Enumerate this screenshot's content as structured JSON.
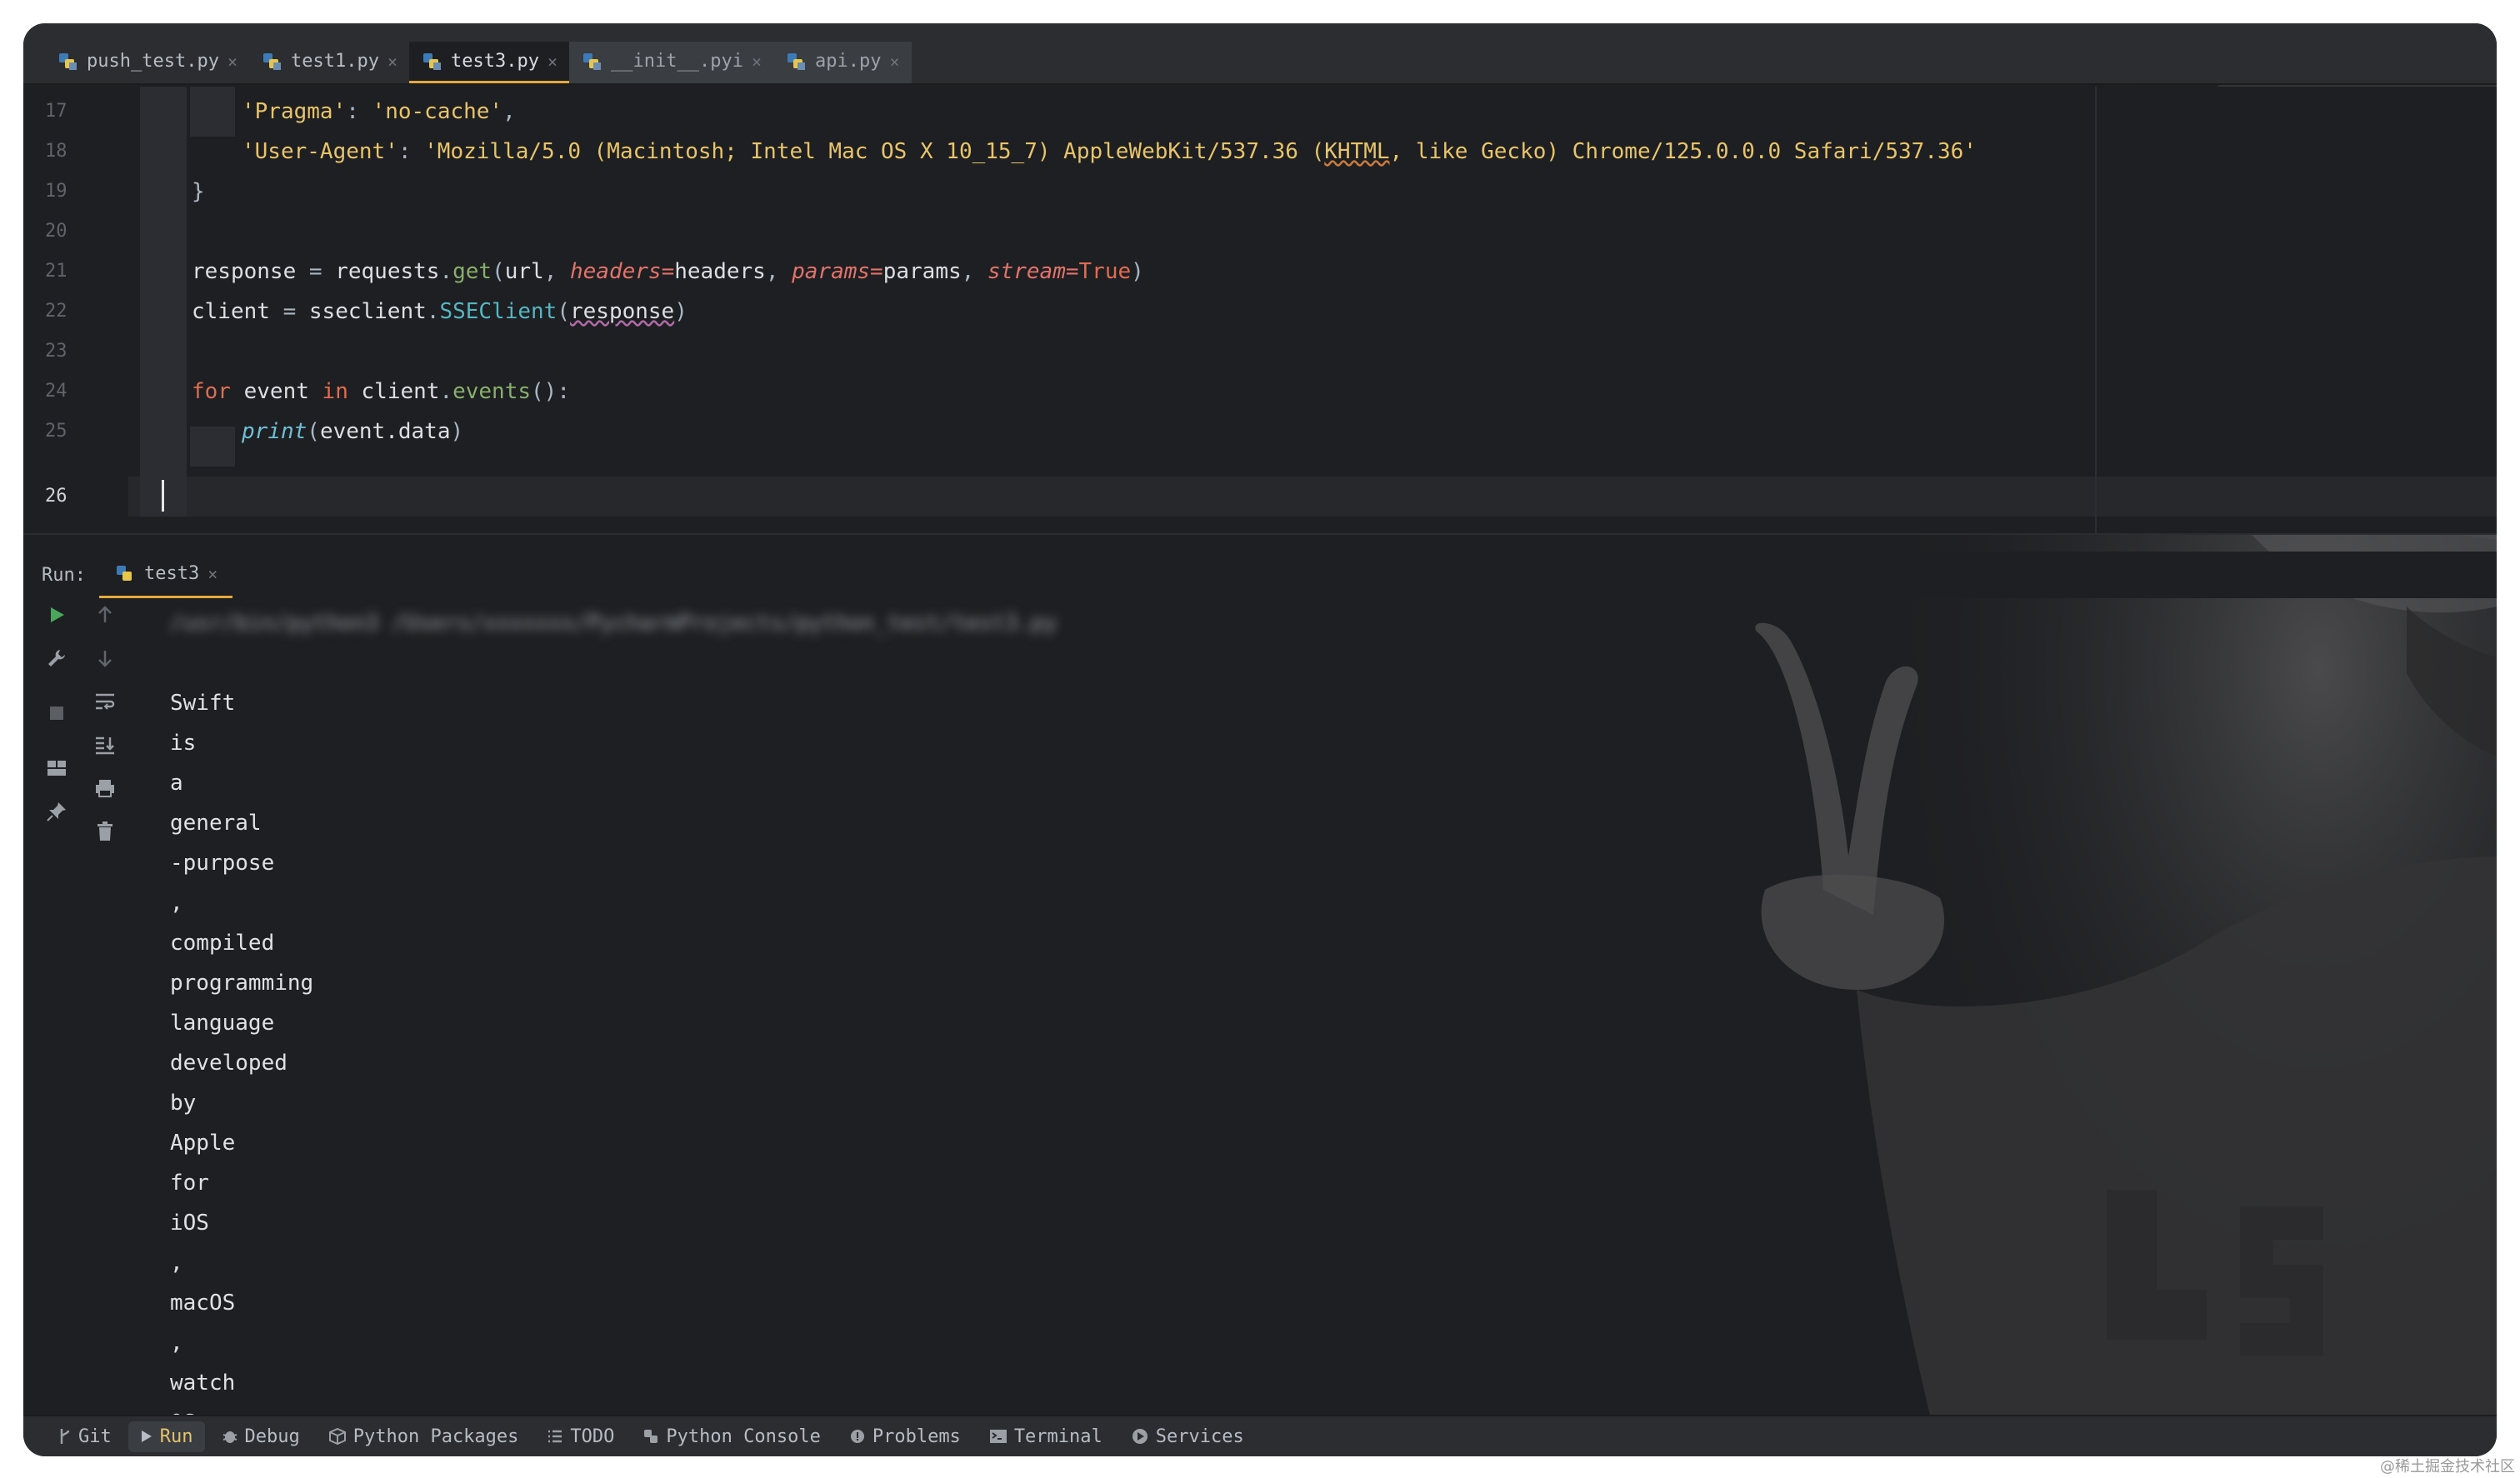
{
  "colors": {
    "window_bg": "#1e1f22",
    "panel_bg": "#2b2d30",
    "accent_tab_underline": "#e5a93c",
    "run_green": "#4aa65a"
  },
  "tabs": [
    {
      "label": "push_test.py",
      "icon": "python-file-icon",
      "state": "normal"
    },
    {
      "label": "test1.py",
      "icon": "python-file-icon",
      "state": "normal"
    },
    {
      "label": "test3.py",
      "icon": "python-file-icon",
      "state": "active"
    },
    {
      "label": "__init__.pyi",
      "icon": "python-file-icon",
      "state": "muted"
    },
    {
      "label": "api.py",
      "icon": "python-file-icon",
      "state": "muted"
    }
  ],
  "editor": {
    "line_numbers": [
      "17",
      "18",
      "19",
      "20",
      "21",
      "22",
      "23",
      "24",
      "25",
      "26"
    ],
    "current_line": "26",
    "lines": {
      "l17": {
        "str": "'Pragma'",
        "colon": ": ",
        "val": "'no-cache'",
        "comma": ","
      },
      "l18": {
        "str": "'User-Agent'",
        "colon": ": ",
        "val_a": "'Mozilla/5.0 (Macintosh; Intel Mac OS X 10_15_7) AppleWebKit/537.36 (",
        "val_khtml": "KHTML",
        "val_b": ", like Gecko) Chrome/125.0.0.0 Safari/537.36'"
      },
      "l19": {
        "brace": "}"
      },
      "l21": {
        "var": "response",
        "eq": " = ",
        "mod": "requests",
        "dot": ".",
        "fn": "get",
        "open": "(",
        "a1": "url",
        "sep1": ", ",
        "p1": "headers",
        "e1": "=",
        "v1": "headers",
        "sep2": ", ",
        "p2": "params",
        "e2": "=",
        "v2": "params",
        "sep3": ", ",
        "p3": "stream",
        "e3": "=",
        "v3": "True",
        "close": ")"
      },
      "l22": {
        "var": "client",
        "eq": " = ",
        "mod": "sseclient",
        "dot": ".",
        "fn": "SSEClient",
        "open": "(",
        "arg": "response",
        "close": ")"
      },
      "l24": {
        "kw1": "for",
        "v1": " event ",
        "kw2": "in",
        "v2": " client",
        "dot": ".",
        "fn": "events",
        "rest": "():"
      },
      "l25": {
        "builtin": "print",
        "open": "(",
        "arg": "event.data",
        "close": ")"
      }
    }
  },
  "run": {
    "label": "Run:",
    "tab_label": "test3",
    "command_blurred": "/usr/bin/python3 /Users/xxxxxxx/PycharmProjects/python_test/test3.py",
    "output": [
      "Swift",
      "is",
      "a",
      "general",
      "-purpose",
      ",",
      "compiled",
      "programming",
      "language",
      "developed",
      "by",
      "Apple",
      "for",
      "iOS",
      ",",
      "macOS",
      ",",
      "watch",
      "OS"
    ]
  },
  "statusbar": [
    {
      "label": "Git",
      "icon": "git-branch-icon"
    },
    {
      "label": "Run",
      "icon": "run-icon",
      "active": true
    },
    {
      "label": "Debug",
      "icon": "bug-icon"
    },
    {
      "label": "Python Packages",
      "icon": "packages-icon"
    },
    {
      "label": "TODO",
      "icon": "list-icon"
    },
    {
      "label": "Python Console",
      "icon": "python-console-icon"
    },
    {
      "label": "Problems",
      "icon": "problems-icon"
    },
    {
      "label": "Terminal",
      "icon": "terminal-icon"
    },
    {
      "label": "Services",
      "icon": "services-icon"
    }
  ],
  "watermark": "@稀土掘金技术社区"
}
